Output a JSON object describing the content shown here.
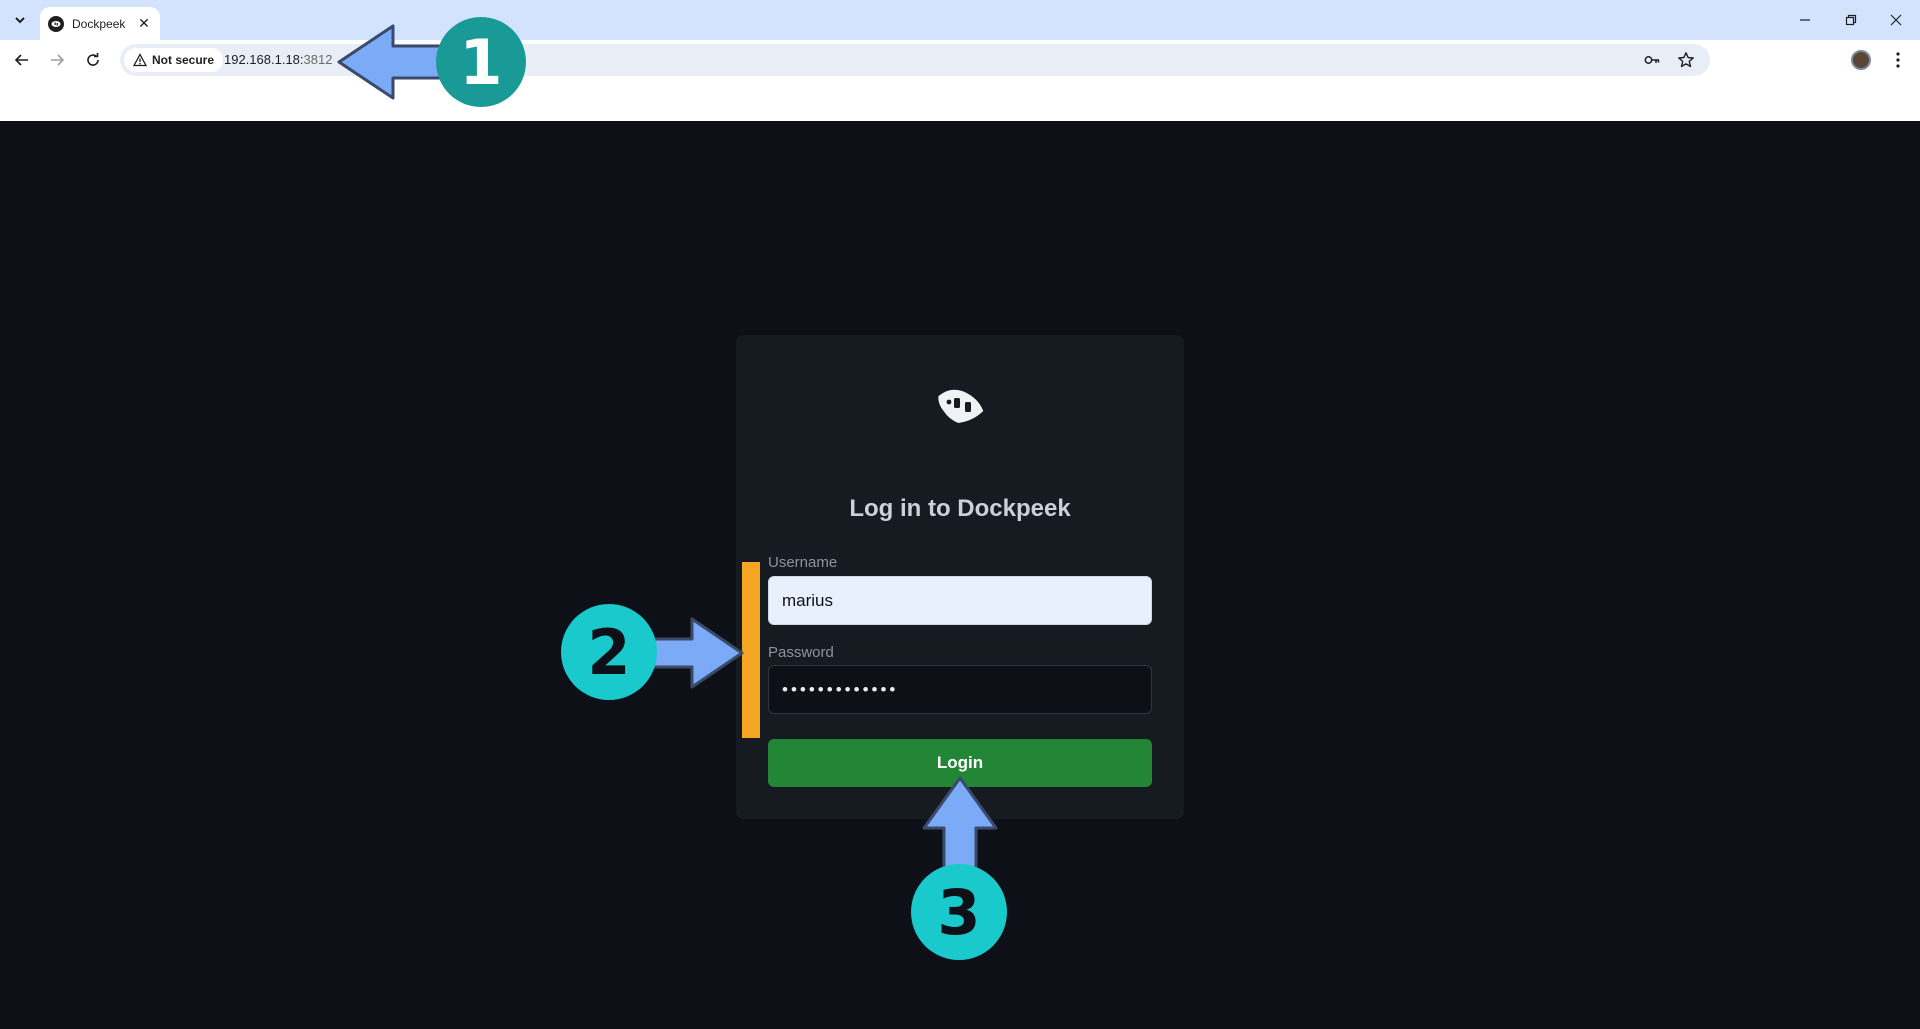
{
  "browser": {
    "tab": {
      "title": "Dockpeek",
      "favicon": "dockpeek-icon"
    },
    "address": {
      "security_label": "Not secure",
      "url_host": "192.168.1.18:",
      "url_port": "3812"
    }
  },
  "page": {
    "title": "Log in to Dockpeek",
    "username": {
      "label": "Username",
      "value": "marius"
    },
    "password": {
      "label": "Password",
      "value": "•••••••••••••"
    },
    "login_button": "Login"
  },
  "annotations": {
    "step1": "1",
    "step2": "2",
    "step3": "3"
  },
  "colors": {
    "page_bg": "#0d1117",
    "card_bg": "#161b22",
    "login_green": "#238636",
    "highlight_orange": "#f5a623",
    "arrow_blue": "#7baaf7",
    "badge_teal": "#19c9cc"
  }
}
